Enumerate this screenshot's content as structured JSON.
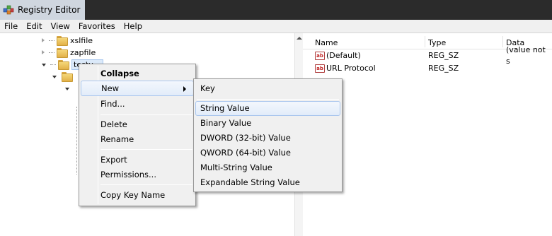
{
  "window": {
    "title": "Registry Editor"
  },
  "menubar": {
    "items": [
      "File",
      "Edit",
      "View",
      "Favorites",
      "Help"
    ]
  },
  "tree": {
    "items": [
      {
        "label": "xslfile",
        "expanded": false
      },
      {
        "label": "zapfile",
        "expanded": false
      },
      {
        "label": "testu...",
        "expanded": true,
        "selected": true
      }
    ]
  },
  "list": {
    "columns": [
      "Name",
      "Type",
      "Data"
    ],
    "rows": [
      {
        "name": "(Default)",
        "type": "REG_SZ",
        "data": "(value not s",
        "icon": "string-value-icon"
      },
      {
        "name": "URL Protocol",
        "type": "REG_SZ",
        "data": "",
        "icon": "string-value-icon"
      }
    ]
  },
  "context_menu": {
    "items": [
      "Collapse",
      "New",
      "Find...",
      "Delete",
      "Rename",
      "Export",
      "Permissions...",
      "Copy Key Name"
    ]
  },
  "submenu": {
    "items": [
      "Key",
      "String Value",
      "Binary Value",
      "DWORD (32-bit) Value",
      "QWORD (64-bit) Value",
      "Multi-String Value",
      "Expandable String Value"
    ]
  },
  "colors": {
    "hover_border": "#a9c6ee",
    "hover_fill": "#e2ecf9",
    "menu_bg": "#f0f0f0"
  }
}
